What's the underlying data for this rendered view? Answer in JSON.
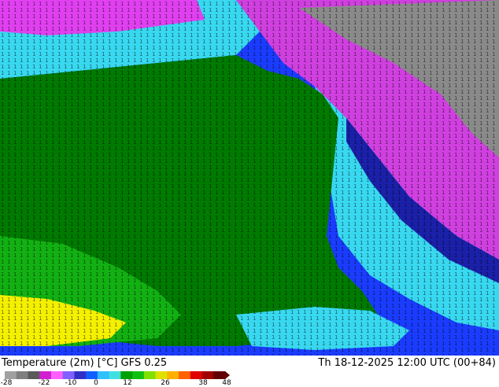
{
  "footer": {
    "left_title": "Temperature (2m) [°C] GFS 0.25",
    "right_title": "Th 18-12-2025 12:00 UTC (00+84)"
  },
  "colorbar": {
    "tick_labels": [
      "-28",
      "-22",
      "-10",
      "0",
      "12",
      "26",
      "38",
      "48"
    ],
    "colors": [
      "#a0a0a0",
      "#7f7f7f",
      "#5a5a5a",
      "#d020d0",
      "#ff60ff",
      "#8060ff",
      "#3030c8",
      "#1060ff",
      "#30c0ff",
      "#40e0e0",
      "#00a000",
      "#10c010",
      "#80e000",
      "#e0e000",
      "#ffb000",
      "#ff6000",
      "#e00000",
      "#a00000",
      "#600000"
    ]
  },
  "map_colors": {
    "land_green": "#007a00",
    "bright_green": "#12b012",
    "ocean_blue": "#1a3cff",
    "dark_blue": "#1a20a8",
    "cyan": "#38d8f0",
    "magenta": "#e040f0",
    "gray": "#808080",
    "yellow": "#f4f000"
  }
}
